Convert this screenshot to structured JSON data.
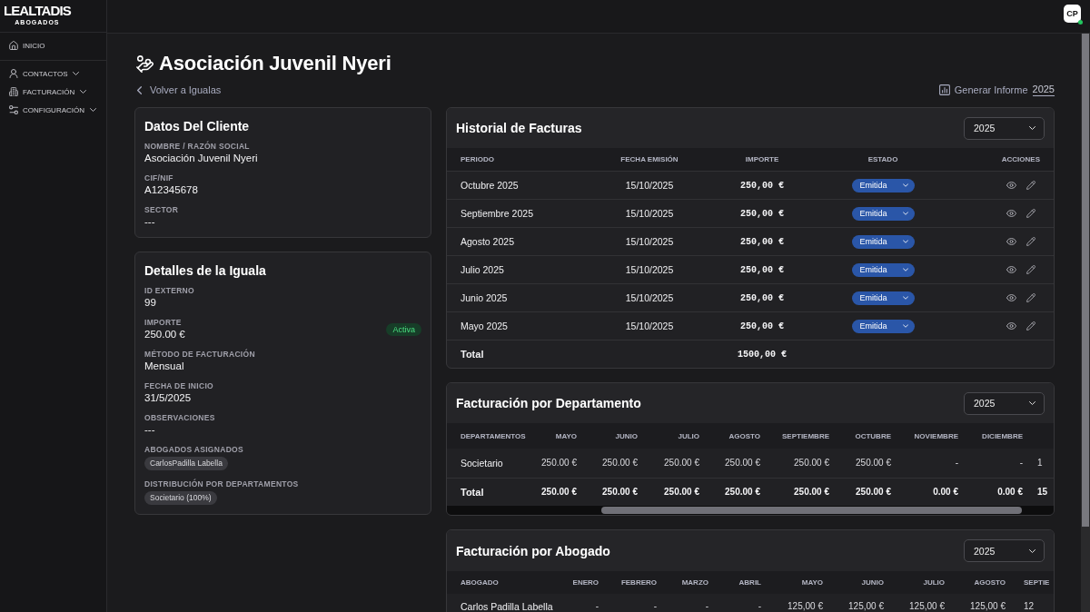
{
  "sidebar": {
    "logo": {
      "wordmark": "LEALTADIS",
      "tagline": "ABOGADOS"
    },
    "top_items": [
      {
        "label": "INICIO"
      }
    ],
    "groups": [
      {
        "label": "CONTACTOS",
        "expanded": false
      },
      {
        "label": "FACTURACIÓN",
        "expanded": false
      },
      {
        "label": "CONFIGURACIÓN",
        "expanded": false
      }
    ]
  },
  "top_bar": {
    "user": {
      "initials": "CP",
      "online": true
    }
  },
  "header": {
    "title": "Asociación Juvenil Nyeri",
    "back_link": "Volver a Igualas",
    "report_button": "Generar Informe",
    "report_year": "2025"
  },
  "client_card": {
    "title": "Datos Del Cliente",
    "fields": [
      {
        "label": "NOMBRE / RAZÓN SOCIAL",
        "value": "Asociación Juvenil Nyeri"
      },
      {
        "label": "CIF/NIF",
        "value": "A12345678"
      },
      {
        "label": "SECTOR",
        "value": "---"
      }
    ]
  },
  "iguala_card": {
    "title": "Detalles de la Iguala",
    "fields": [
      {
        "kind": "text",
        "label": "ID EXTERNO",
        "value": "99"
      },
      {
        "kind": "text",
        "label": "IMPORTE",
        "value": "250.00 €",
        "badge": "Activa"
      },
      {
        "kind": "text",
        "label": "MÉTODO DE FACTURACIÓN",
        "value": "Mensual"
      },
      {
        "kind": "text",
        "label": "FECHA DE INICIO",
        "value": "31/5/2025"
      },
      {
        "kind": "text",
        "label": "OBSERVACIONES",
        "value": "---"
      },
      {
        "kind": "chips",
        "label": "ABOGADOS ASIGNADOS",
        "chips": [
          "CarlosPadilla Labella"
        ]
      },
      {
        "kind": "chips",
        "label": "DISTRIBUCIÓN POR DEPARTAMENTOS",
        "chips": [
          "Societario (100%)"
        ]
      }
    ]
  },
  "invoice_history": {
    "title": "Historial de Facturas",
    "year": "2025",
    "columns": [
      "PERIODO",
      "FECHA EMISIÓN",
      "IMPORTE",
      "ESTADO",
      "ACCIONES"
    ],
    "rows": [
      {
        "period": "Octubre 2025",
        "issue_date": "15/10/2025",
        "amount": "250,00 €",
        "status": "Emitida"
      },
      {
        "period": "Septiembre 2025",
        "issue_date": "15/10/2025",
        "amount": "250,00 €",
        "status": "Emitida"
      },
      {
        "period": "Agosto 2025",
        "issue_date": "15/10/2025",
        "amount": "250,00 €",
        "status": "Emitida"
      },
      {
        "period": "Julio 2025",
        "issue_date": "15/10/2025",
        "amount": "250,00 €",
        "status": "Emitida"
      },
      {
        "period": "Junio 2025",
        "issue_date": "15/10/2025",
        "amount": "250,00 €",
        "status": "Emitida"
      },
      {
        "period": "Mayo 2025",
        "issue_date": "15/10/2025",
        "amount": "250,00 €",
        "status": "Emitida"
      }
    ],
    "total": {
      "label": "Total",
      "amount": "1500,00 €"
    }
  },
  "department_billing": {
    "title": "Facturación por Departamento",
    "year": "2025",
    "columns": [
      "DEPARTAMENTOS",
      "MAYO",
      "JUNIO",
      "JULIO",
      "AGOSTO",
      "SEPTIEMBRE",
      "OCTUBRE",
      "NOVIEMBRE",
      "DICIEMBRE"
    ],
    "rows": [
      {
        "cells": [
          "Societario",
          "250.00 €",
          "250.00 €",
          "250.00 €",
          "250.00 €",
          "250.00 €",
          "250.00 €",
          "-",
          "-",
          "1"
        ]
      }
    ],
    "total": {
      "cells": [
        "Total",
        "250.00 €",
        "250.00 €",
        "250.00 €",
        "250.00 €",
        "250.00 €",
        "250.00 €",
        "0.00 €",
        "0.00 €",
        "15"
      ]
    }
  },
  "lawyer_billing": {
    "title": "Facturación por Abogado",
    "year": "2025",
    "columns": [
      "ABOGADO",
      "ENERO",
      "FEBRERO",
      "MARZO",
      "ABRIL",
      "MAYO",
      "JUNIO",
      "JULIO",
      "AGOSTO",
      "SEPTIE"
    ],
    "rows": [
      {
        "cells": [
          "Carlos Padilla Labella",
          "-",
          "-",
          "-",
          "-",
          "125,00 €",
          "125,00 €",
          "125,00 €",
          "125,00 €",
          "12"
        ]
      }
    ]
  }
}
